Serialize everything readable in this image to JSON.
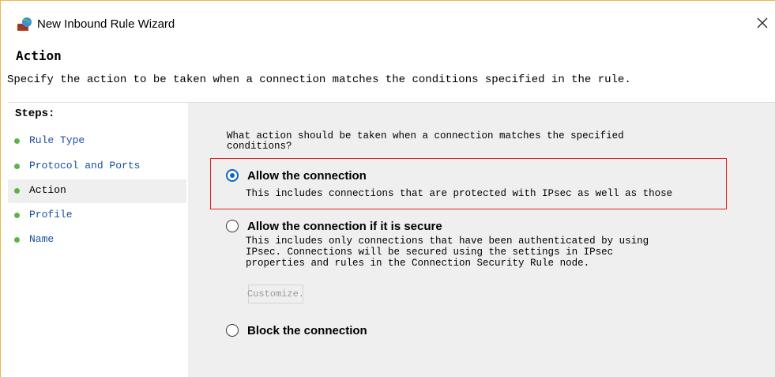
{
  "window": {
    "title": "New Inbound Rule Wizard",
    "close_symbol": "✕"
  },
  "header": {
    "title": "Action",
    "description": "Specify the action to be taken when a connection matches the conditions specified in the rule."
  },
  "steps": {
    "heading": "Steps:",
    "items": [
      {
        "label": "Rule Type",
        "current": false
      },
      {
        "label": "Protocol and Ports",
        "current": false
      },
      {
        "label": "Action",
        "current": true
      },
      {
        "label": "Profile",
        "current": false
      },
      {
        "label": "Name",
        "current": false
      }
    ]
  },
  "main": {
    "question_line1": "What action should be taken when a connection matches the specified",
    "question_line2": "conditions?",
    "options": [
      {
        "title": "Allow the connection",
        "desc": [
          "This includes connections that are protected with IPsec as well as those"
        ],
        "checked": true
      },
      {
        "title": "Allow the connection if it is secure",
        "desc": [
          "This includes only connections that have been authenticated by using",
          "IPsec.  Connections will be secured using the settings in IPsec",
          "properties and rules in the Connection Security Rule node."
        ],
        "checked": false
      },
      {
        "title": "Block the connection",
        "desc": [],
        "checked": false
      }
    ],
    "customize_label": "Customize."
  },
  "colors": {
    "highlight": "#e02020",
    "radio_selected": "#0a64c8",
    "step_bullet": "#5fb247",
    "step_link": "#1a4fa0"
  }
}
